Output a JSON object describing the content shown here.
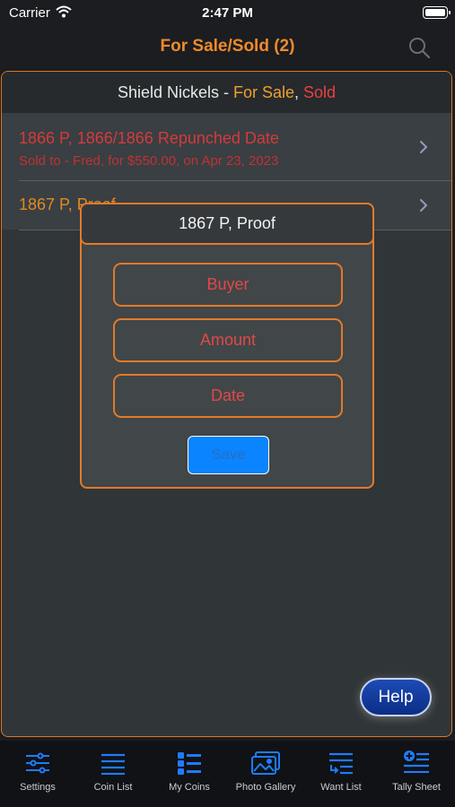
{
  "status_bar": {
    "carrier": "Carrier",
    "time": "2:47 PM"
  },
  "nav": {
    "title": "For Sale/Sold (2)",
    "search_icon": "search-icon"
  },
  "section": {
    "name": "Shield Nickels",
    "separator": " - ",
    "for_sale": "For Sale",
    "comma": ", ",
    "sold": "Sold"
  },
  "rows": [
    {
      "title": "1866 P, 1866/1866 Repunched Date",
      "subtitle": "Sold to - Fred, for $550.00, on Apr 23, 2023"
    },
    {
      "title": "1867 P, Proof"
    }
  ],
  "modal": {
    "title": "1867 P, Proof",
    "buyer_placeholder": "Buyer",
    "amount_placeholder": "Amount",
    "date_placeholder": "Date",
    "save_label": "Save"
  },
  "help": {
    "label": "Help"
  },
  "tabs": [
    {
      "label": "Settings",
      "icon": "sliders-icon"
    },
    {
      "label": "Coin List",
      "icon": "list-icon"
    },
    {
      "label": "My Coins",
      "icon": "grid-list-icon"
    },
    {
      "label": "Photo Gallery",
      "icon": "photos-icon"
    },
    {
      "label": "Want List",
      "icon": "want-list-icon"
    },
    {
      "label": "Tally Sheet",
      "icon": "tally-add-icon"
    }
  ],
  "colors": {
    "accent": "#f08a2c",
    "sold": "#e94040",
    "for_sale": "#f0a030",
    "tab_icon": "#1f7bff"
  }
}
